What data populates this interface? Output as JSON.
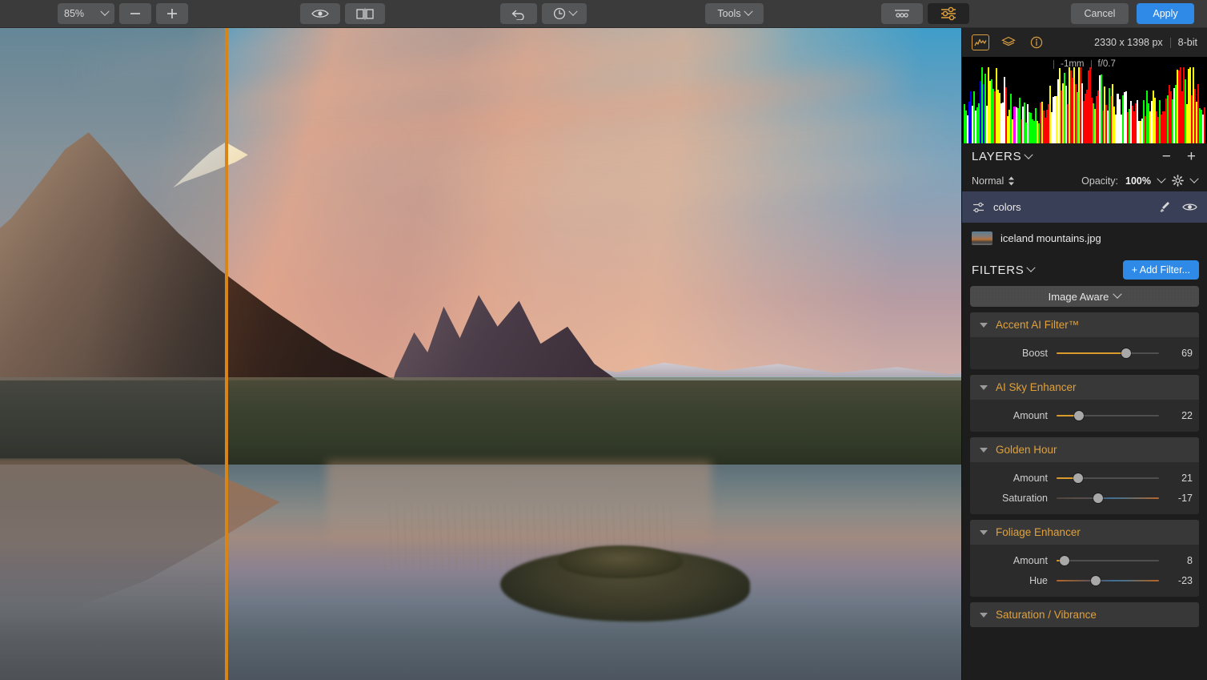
{
  "toolbar": {
    "zoom_value": "85%",
    "zoom_out_label": "−",
    "zoom_in_label": "+",
    "preview_icon": "eye-icon",
    "compare_icon": "split-compare-icon",
    "undo_icon": "undo-arrow-icon",
    "history_icon": "history-clock-icon",
    "tools_label": "Tools",
    "presets_icon": "presets-panel-icon",
    "adjust_icon": "adjust-sliders-icon",
    "cancel_label": "Cancel",
    "apply_label": "Apply"
  },
  "panel": {
    "tabs": [
      {
        "name": "histogram-icon",
        "active": true
      },
      {
        "name": "layers-icon",
        "active": false
      },
      {
        "name": "info-icon",
        "active": false
      }
    ],
    "image_size": "2330 x 1398 px",
    "bit_depth": "8-bit",
    "histogram": {
      "focal_length": "-1mm",
      "aperture": "f/0.7"
    },
    "layers": {
      "title": "LAYERS",
      "remove_label": "−",
      "add_label": "+",
      "blend_mode": "Normal",
      "opacity_label": "Opacity:",
      "opacity_value": "100%",
      "settings_icon": "gear-icon",
      "items": [
        {
          "name": "colors",
          "type": "adjustment",
          "selected": true,
          "brush_icon": "brush-icon",
          "visible_icon": "eye-icon"
        },
        {
          "name": "iceland mountains.jpg",
          "type": "image",
          "selected": false
        }
      ]
    },
    "filters": {
      "title": "FILTERS",
      "add_filter_label": "+ Add Filter...",
      "mode": "Image Aware",
      "items": [
        {
          "name": "Accent AI Filter™",
          "expanded": true,
          "sliders": [
            {
              "label": "Boost",
              "value": "69",
              "pct": 68,
              "bipolar": false
            }
          ]
        },
        {
          "name": "AI Sky Enhancer",
          "expanded": true,
          "sliders": [
            {
              "label": "Amount",
              "value": "22",
              "pct": 22,
              "bipolar": false
            }
          ]
        },
        {
          "name": "Golden Hour",
          "expanded": true,
          "sliders": [
            {
              "label": "Amount",
              "value": "21",
              "pct": 21,
              "bipolar": false
            },
            {
              "label": "Saturation",
              "value": "-17",
              "pct": 41,
              "bipolar": true
            }
          ]
        },
        {
          "name": "Foliage Enhancer",
          "expanded": true,
          "sliders": [
            {
              "label": "Amount",
              "value": "8",
              "pct": 8,
              "bipolar": false
            },
            {
              "label": "Hue",
              "value": "-23",
              "pct": 38,
              "bipolar": true
            }
          ]
        },
        {
          "name": "Saturation / Vibrance",
          "expanded": true,
          "sliders": []
        }
      ]
    }
  },
  "canvas": {
    "divider_color": "#d98516",
    "divider_x_pct": 23.5
  }
}
